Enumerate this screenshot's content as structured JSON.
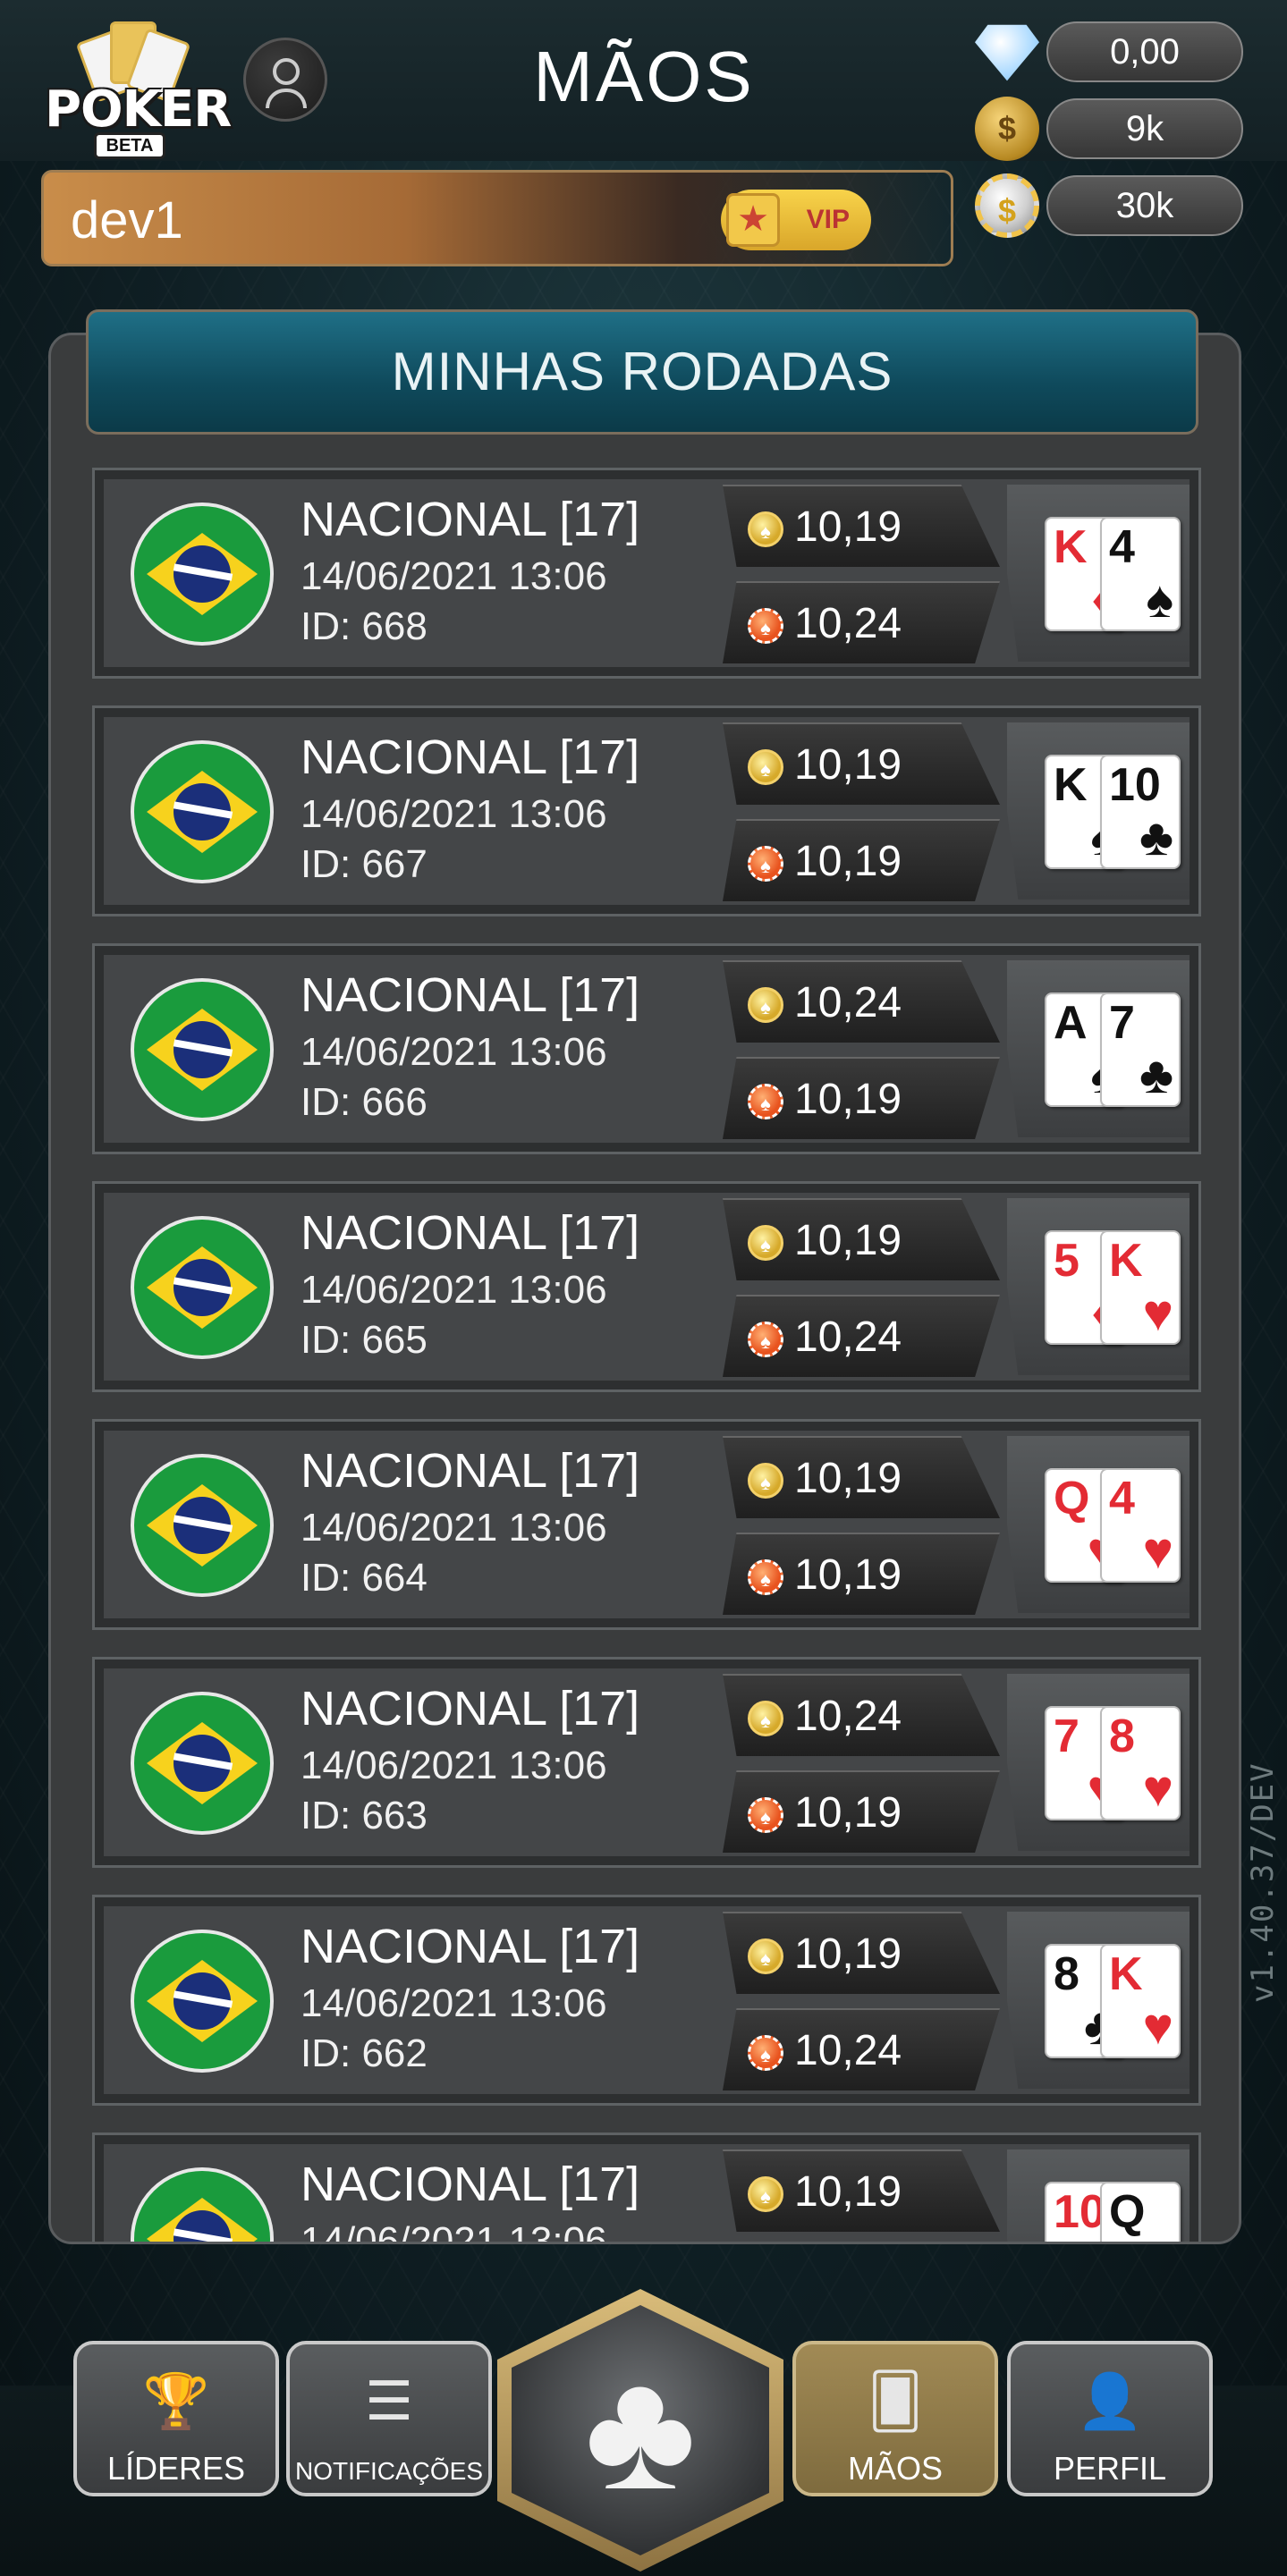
{
  "header": {
    "logo_text": "POKER",
    "logo_badge": "BETA",
    "title": "MÃOS",
    "username": "dev1",
    "vip_label": "VIP"
  },
  "balances": [
    {
      "icon": "diamond-icon",
      "value": "0,00"
    },
    {
      "icon": "gold-coin-icon",
      "value": "9k"
    },
    {
      "icon": "chip-icon",
      "value": "30k"
    }
  ],
  "panel": {
    "title": "MINHAS RODADAS"
  },
  "rounds": [
    {
      "title": "NACIONAL [17]",
      "date": "14/06/2021 13:06",
      "id": "ID: 668",
      "stat_top": "10,19",
      "stat_bottom": "10,24",
      "cards": [
        {
          "rank": "K",
          "suit": "♦",
          "color": "red"
        },
        {
          "rank": "4",
          "suit": "♠",
          "color": "black"
        }
      ]
    },
    {
      "title": "NACIONAL [17]",
      "date": "14/06/2021 13:06",
      "id": "ID: 667",
      "stat_top": "10,19",
      "stat_bottom": "10,19",
      "cards": [
        {
          "rank": "K",
          "suit": "♠",
          "color": "black"
        },
        {
          "rank": "10",
          "suit": "♣",
          "color": "black"
        }
      ]
    },
    {
      "title": "NACIONAL [17]",
      "date": "14/06/2021 13:06",
      "id": "ID: 666",
      "stat_top": "10,24",
      "stat_bottom": "10,19",
      "cards": [
        {
          "rank": "A",
          "suit": "♠",
          "color": "black"
        },
        {
          "rank": "7",
          "suit": "♣",
          "color": "black"
        }
      ]
    },
    {
      "title": "NACIONAL [17]",
      "date": "14/06/2021 13:06",
      "id": "ID: 665",
      "stat_top": "10,19",
      "stat_bottom": "10,24",
      "cards": [
        {
          "rank": "5",
          "suit": "♦",
          "color": "red"
        },
        {
          "rank": "K",
          "suit": "♥",
          "color": "red"
        }
      ]
    },
    {
      "title": "NACIONAL [17]",
      "date": "14/06/2021 13:06",
      "id": "ID: 664",
      "stat_top": "10,19",
      "stat_bottom": "10,19",
      "cards": [
        {
          "rank": "Q",
          "suit": "♥",
          "color": "red"
        },
        {
          "rank": "4",
          "suit": "♥",
          "color": "red"
        }
      ]
    },
    {
      "title": "NACIONAL [17]",
      "date": "14/06/2021 13:06",
      "id": "ID: 663",
      "stat_top": "10,24",
      "stat_bottom": "10,19",
      "cards": [
        {
          "rank": "7",
          "suit": "♥",
          "color": "red"
        },
        {
          "rank": "8",
          "suit": "♥",
          "color": "red"
        }
      ]
    },
    {
      "title": "NACIONAL [17]",
      "date": "14/06/2021 13:06",
      "id": "ID: 662",
      "stat_top": "10,19",
      "stat_bottom": "10,24",
      "cards": [
        {
          "rank": "8",
          "suit": "♣",
          "color": "black"
        },
        {
          "rank": "K",
          "suit": "♥",
          "color": "red"
        }
      ]
    },
    {
      "title": "NACIONAL [17]",
      "date": "14/06/2021 13:06",
      "id": "",
      "stat_top": "10,19",
      "stat_bottom": "",
      "cards": [
        {
          "rank": "10",
          "suit": "♦",
          "color": "red"
        },
        {
          "rank": "Q",
          "suit": "♠",
          "color": "black"
        }
      ]
    }
  ],
  "version": "v1.40.37/DEV",
  "nav": {
    "leaders": "LÍDERES",
    "notifications": "NOTIFICAÇÕES",
    "hands": "MÃOS",
    "profile": "PERFIL",
    "center_symbol": "♣"
  },
  "colors": {
    "panel_header": "#1f6f86",
    "active_nav": "#a18a55",
    "card_red": "#e32b34"
  }
}
